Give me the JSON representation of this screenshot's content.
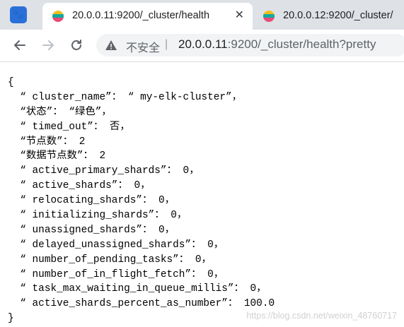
{
  "tabs": [
    {
      "title": "20.0.0.11:9200/_cluster/health"
    },
    {
      "title": "20.0.0.12:9200/_cluster/"
    }
  ],
  "address_bar": {
    "security_label": "不安全",
    "separator": "|",
    "url_host": "20.0.0.11",
    "url_rest": ":9200/_cluster/health?pretty"
  },
  "json_lines": [
    "{",
    "  “ cluster_name”： “ my-elk-cluster”，",
    "  “状态”： “绿色”，",
    "  “ timed_out”： 否，",
    "  “节点数”： 2",
    "  “数据节点数”： 2",
    "  “ active_primary_shards”： 0，",
    "  “ active_shards”： 0，",
    "  “ relocating_shards”： 0，",
    "  “ initializing_shards”： 0，",
    "  “ unassigned_shards”： 0，",
    "  “ delayed_unassigned_shards”： 0，",
    "  “ number_of_pending_tasks”： 0，",
    "  “ number_of_in_flight_fetch”： 0，",
    "  “ task_max_waiting_in_queue_millis”： 0，",
    "  “ active_shards_percent_as_number”： 100.0",
    "}"
  ],
  "watermark": "https://blog.csdn.net/weixin_48760717"
}
